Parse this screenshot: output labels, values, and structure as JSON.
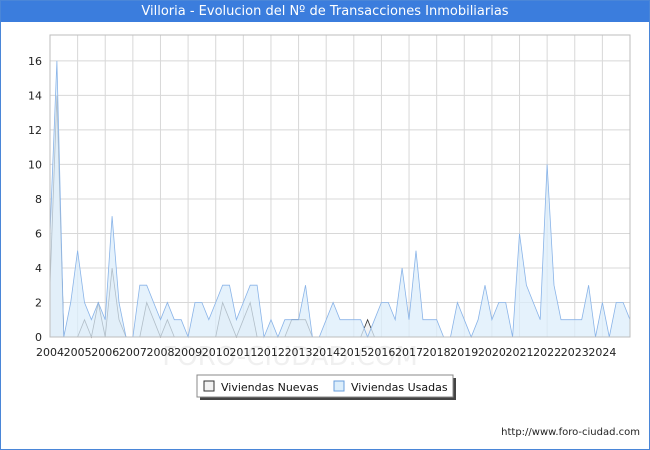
{
  "title": "Villoria - Evolucion del Nº de Transacciones Inmobiliarias",
  "source": "http://www.foro-ciudad.com",
  "watermark": "FORO-CIUDAD.COM",
  "colors": {
    "header": "#3b7ddd",
    "nuevas_fill": "#f2f2f2",
    "nuevas_line": "#333333",
    "usadas_fill": "#dceefb",
    "usadas_line": "#8ab4e8",
    "grid": "#d8d8d8"
  },
  "chart_data": {
    "type": "area",
    "xlabel": "",
    "ylabel": "",
    "ylim": [
      0,
      17.5
    ],
    "yticks": [
      0,
      2,
      4,
      6,
      8,
      10,
      12,
      14,
      16
    ],
    "xlim": [
      2004,
      2025
    ],
    "xticks": [
      "2004",
      "2005",
      "2006",
      "2007",
      "2008",
      "2009",
      "2010",
      "2011",
      "2012",
      "2013",
      "2014",
      "2015",
      "2016",
      "2017",
      "2018",
      "2019",
      "2020",
      "2021",
      "2022",
      "2023",
      "2024"
    ],
    "grid": true,
    "legend_position": "bottom-center",
    "x_start": "2004 Q1",
    "period": "quarterly",
    "series": [
      {
        "name": "Viviendas Nuevas",
        "values": [
          3,
          14,
          0,
          0,
          0,
          1,
          0,
          2,
          0,
          4,
          1,
          0,
          0,
          0,
          2,
          1,
          0,
          1,
          0,
          0,
          0,
          0,
          0,
          0,
          0,
          2,
          1,
          0,
          1,
          2,
          0,
          0,
          0,
          0,
          0,
          1,
          1,
          1,
          0,
          0,
          0,
          0,
          0,
          0,
          0,
          0,
          1,
          0,
          0,
          0,
          0,
          0,
          0,
          0,
          0,
          0,
          0,
          0,
          0,
          0,
          0,
          0,
          0,
          0,
          0,
          0,
          0,
          0,
          0,
          0,
          0,
          0,
          0,
          0,
          0,
          0,
          0,
          0,
          0,
          0,
          0,
          0,
          0,
          0
        ]
      },
      {
        "name": "Viviendas Usadas",
        "values": [
          6,
          16,
          0,
          2,
          5,
          2,
          1,
          2,
          1,
          7,
          2,
          0,
          0,
          3,
          3,
          2,
          1,
          2,
          1,
          1,
          0,
          2,
          2,
          1,
          2,
          3,
          3,
          1,
          2,
          3,
          3,
          0,
          1,
          0,
          1,
          1,
          1,
          3,
          0,
          0,
          1,
          2,
          1,
          1,
          1,
          1,
          0,
          1,
          2,
          2,
          1,
          4,
          1,
          5,
          1,
          1,
          1,
          0,
          0,
          2,
          1,
          0,
          1,
          3,
          1,
          2,
          2,
          0,
          6,
          3,
          2,
          1,
          10,
          3,
          1,
          1,
          1,
          1,
          3,
          0,
          2,
          0,
          2,
          2,
          1
        ]
      }
    ]
  },
  "legend": [
    {
      "label": "Viviendas Nuevas"
    },
    {
      "label": "Viviendas Usadas"
    }
  ]
}
